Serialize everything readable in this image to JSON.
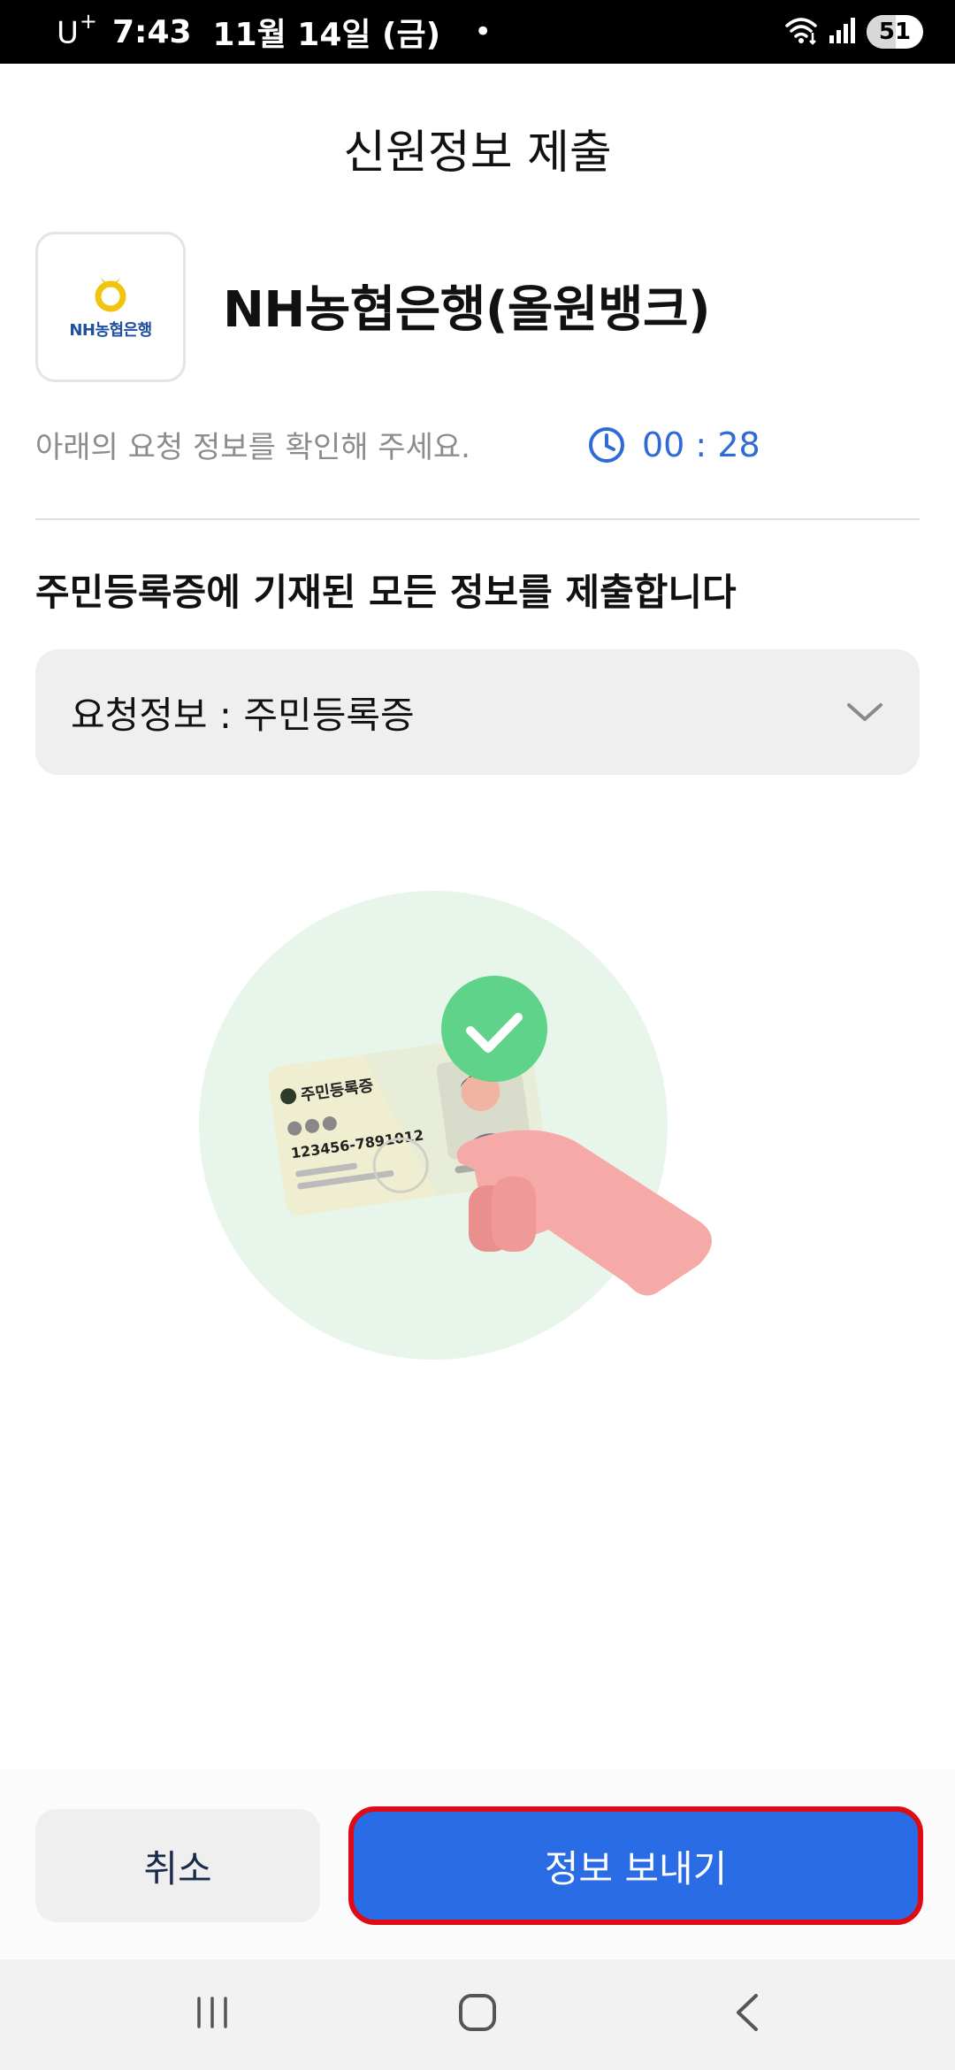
{
  "status_bar": {
    "carrier": "U",
    "carrier_sup": "+",
    "time": "7:43",
    "date": "11월 14일 (금)",
    "dot": "•",
    "battery_level": "51",
    "battery_fraction": 0.51
  },
  "header": {
    "title": "신원정보 제출"
  },
  "bank": {
    "logo_text": "NH농협은행",
    "name": "NH농협은행(올원뱅크)"
  },
  "instruction": "아래의 요청 정보를 확인해 주세요.",
  "timer": {
    "value": "00 : 28",
    "icon": "clock-icon"
  },
  "notice": "주민등록증에 기재된 모든 정보를 제출합니다",
  "request_select": {
    "label": "요청정보 : 주민등록증",
    "icon": "chevron-down-icon"
  },
  "illustration": {
    "card_title": "주민등록증",
    "card_number": "123456-7891012",
    "check_icon": "check-icon"
  },
  "buttons": {
    "cancel": "취소",
    "send": "정보 보내기"
  },
  "colors": {
    "accent": "#2a6be6",
    "highlight_border": "#e00a14",
    "timer": "#2f6bd6",
    "check_green": "#5fd38a"
  },
  "nav": {
    "recents": "recents-icon",
    "home": "home-icon",
    "back": "back-icon"
  }
}
